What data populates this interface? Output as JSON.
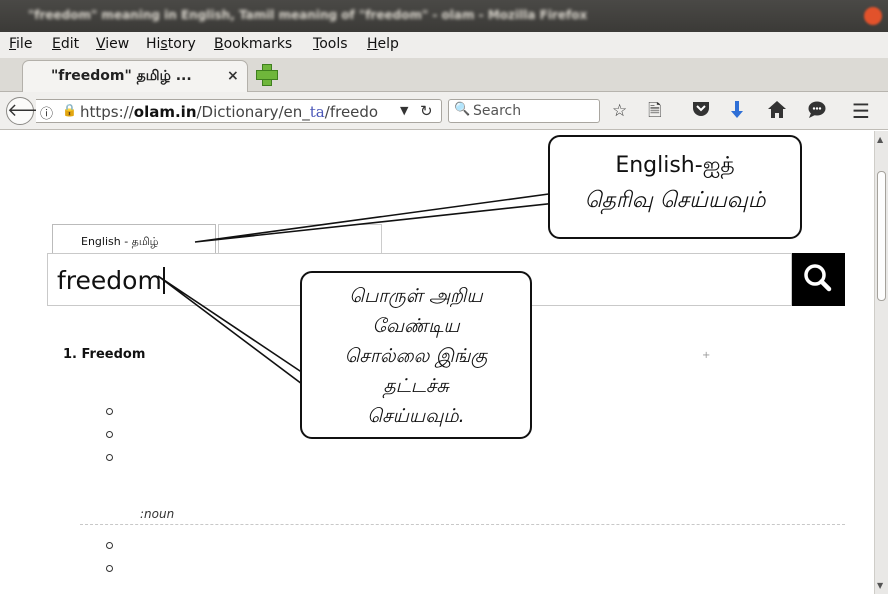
{
  "window": {
    "title": "\"freedom\" meaning in English, Tamil meaning of \"freedom\" - olam - Mozilla Firefox"
  },
  "menu": [
    {
      "pre": "",
      "u": "F",
      "post": "ile"
    },
    {
      "pre": "",
      "u": "E",
      "post": "dit"
    },
    {
      "pre": "",
      "u": "V",
      "post": "iew"
    },
    {
      "pre": "Hi",
      "u": "s",
      "post": "tory"
    },
    {
      "pre": "",
      "u": "B",
      "post": "ookmarks"
    },
    {
      "pre": "",
      "u": "T",
      "post": "ools"
    },
    {
      "pre": "",
      "u": "H",
      "post": "elp"
    }
  ],
  "tab": {
    "title": "\"freedom\" தமிழ் ...",
    "close": "×"
  },
  "nav": {
    "url_prefix": "https://",
    "url_host": "olam.in",
    "url_path_a": "/Dictionary/en_",
    "url_path_ta": "ta",
    "url_path_b": "/freedo",
    "search_placeholder": "Search"
  },
  "page": {
    "lang_tab": "English -  தமிழ்",
    "query": "freedom",
    "result_heading": "1. Freedom",
    "plus": "+",
    "pos": ":noun"
  },
  "callouts": {
    "select_line1": "English-ஐத்",
    "select_line2": "தெரிவு செய்யவும்",
    "type_lines": [
      "பொருள் அறிய",
      "வேண்டிய",
      "சொல்லை இங்கு",
      "தட்டச்சு",
      "செய்யவும்."
    ]
  },
  "icons": {
    "back": "back-arrow-icon",
    "identity": "info-shield-icon",
    "lock": "lock-icon",
    "reload": "reload-icon",
    "search_engine": "search-engine-icon",
    "bookmark_star": "star-icon",
    "reader": "reading-list-icon",
    "pocket": "pocket-icon",
    "downloads": "download-arrow-icon",
    "home": "home-icon",
    "chat": "chat-bubble-icon",
    "menu": "hamburger-menu-icon",
    "new_tab": "new-tab-plus-icon",
    "query_search": "magnifier-icon"
  },
  "colors": {
    "download_arrow": "#2f6fd6",
    "new_tab": "#6fb63b",
    "titlebar": "#3f3e3b",
    "close_button": "#e2522b"
  }
}
